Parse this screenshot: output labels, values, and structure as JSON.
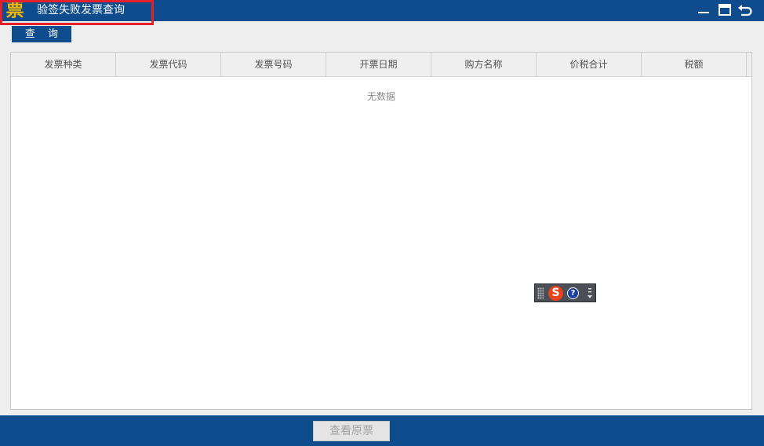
{
  "window": {
    "logo_char": "票",
    "title": "验签失败发票查询"
  },
  "toolbar": {
    "query_label": "查 询"
  },
  "table": {
    "columns": [
      "发票种类",
      "发票代码",
      "发票号码",
      "开票日期",
      "购方名称",
      "价税合计",
      "税额"
    ],
    "empty_text": "无数据"
  },
  "ime": {
    "logo_char": "S",
    "help_char": "?"
  },
  "footer": {
    "view_original_label": "查看原票"
  },
  "colors": {
    "bar_blue": "#0e4c8d",
    "highlight_red": "#e4202a",
    "logo_gold": "#f5b800"
  }
}
